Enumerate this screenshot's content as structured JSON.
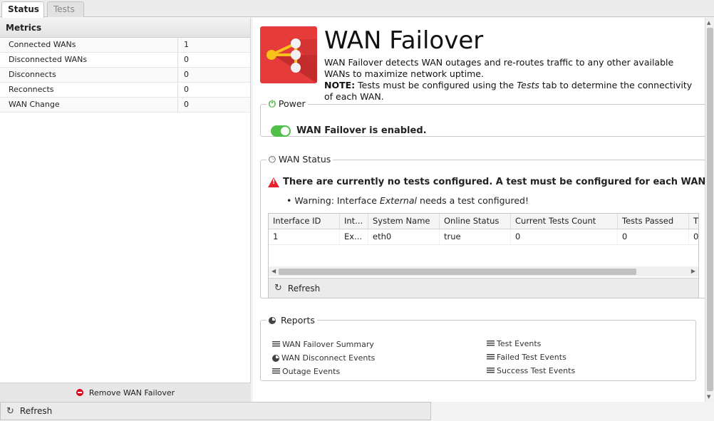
{
  "tabs": {
    "status": "Status",
    "tests": "Tests"
  },
  "metrics": {
    "header": "Metrics",
    "rows": [
      {
        "name": "Connected WANs",
        "value": "1"
      },
      {
        "name": "Disconnected WANs",
        "value": "0"
      },
      {
        "name": "Disconnects",
        "value": "0"
      },
      {
        "name": "Reconnects",
        "value": "0"
      },
      {
        "name": "WAN Change",
        "value": "0"
      }
    ],
    "remove_label": "Remove WAN Failover"
  },
  "bottom": {
    "refresh_label": "Refresh"
  },
  "app": {
    "title": "WAN Failover",
    "description": "WAN Failover detects WAN outages and re-routes traffic to any other available WANs to maximize network uptime.",
    "note_label": "NOTE:",
    "note_before": " Tests must be configured using the ",
    "note_tab": "Tests",
    "note_after": " tab to determine the connectivity of each WAN."
  },
  "power": {
    "legend": "Power",
    "status": "WAN Failover is enabled."
  },
  "wan_status": {
    "legend": "WAN Status",
    "warning": "There are currently no tests configured. A test must be configured for each WAN.",
    "item_before": "Warning: Interface ",
    "item_iface": "External",
    "item_after": " needs a test configured!",
    "columns": [
      "Interface ID",
      "Int...",
      "System Name",
      "Online Status",
      "Current Tests Count",
      "Tests Passed",
      "T"
    ],
    "rows": [
      [
        "1",
        "Ex...",
        "eth0",
        "true",
        "0",
        "0",
        "0"
      ]
    ],
    "refresh_label": "Refresh"
  },
  "reports": {
    "legend": "Reports",
    "left": [
      {
        "label": "WAN Failover Summary",
        "icon": "list-icon"
      },
      {
        "label": "WAN Disconnect Events",
        "icon": "pie-icon"
      },
      {
        "label": "Outage Events",
        "icon": "list-icon"
      }
    ],
    "right": [
      {
        "label": "Test Events",
        "icon": "list-icon"
      },
      {
        "label": "Failed Test Events",
        "icon": "list-icon"
      },
      {
        "label": "Success Test Events",
        "icon": "list-icon"
      }
    ]
  },
  "colors": {
    "accent_red": "#e53b3b",
    "toggle_green": "#50c04a",
    "warning_red": "#e8222c"
  }
}
